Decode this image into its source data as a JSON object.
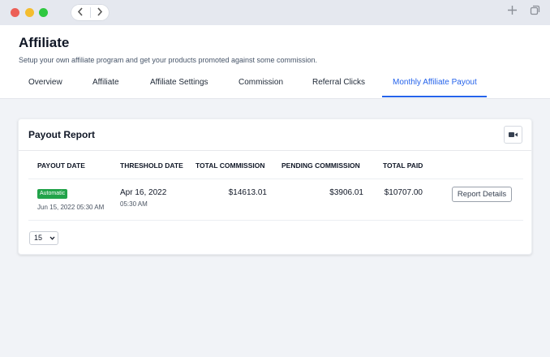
{
  "window": {
    "colors": {
      "close": "#ec5f57",
      "minimize": "#f4bd2f",
      "maximize": "#2fc840"
    },
    "icons": [
      "back-chevron-icon",
      "forward-chevron-icon",
      "plus-icon",
      "copy-window-icon"
    ]
  },
  "page": {
    "title": "Affiliate",
    "subtitle": "Setup your own affiliate program and get your products promoted against some commission."
  },
  "tabs": [
    {
      "label": "Overview"
    },
    {
      "label": "Affiliate"
    },
    {
      "label": "Affiliate Settings"
    },
    {
      "label": "Commission"
    },
    {
      "label": "Referral Clicks"
    },
    {
      "label": "Monthly Affiliate Payout",
      "active": true
    }
  ],
  "card": {
    "title": "Payout Report",
    "icon": "video-camera-icon"
  },
  "table": {
    "headers": [
      "PAYOUT DATE",
      "THRESHOLD DATE",
      "TOTAL COMMISSION",
      "PENDING COMMISSION",
      "TOTAL PAID"
    ],
    "rows": [
      {
        "badge": "Automatic",
        "payout_date": "Jun 15, 2022 05:30 AM",
        "threshold_date": "Apr 16, 2022",
        "threshold_time": "05:30 AM",
        "total_commission": "$14613.01",
        "pending_commission": "$3906.01",
        "total_paid": "$10707.00",
        "action": "Report Details"
      }
    ]
  },
  "pagination": {
    "per_page": "15"
  },
  "accent_color": "#2563eb",
  "badge_color": "#22a34a"
}
